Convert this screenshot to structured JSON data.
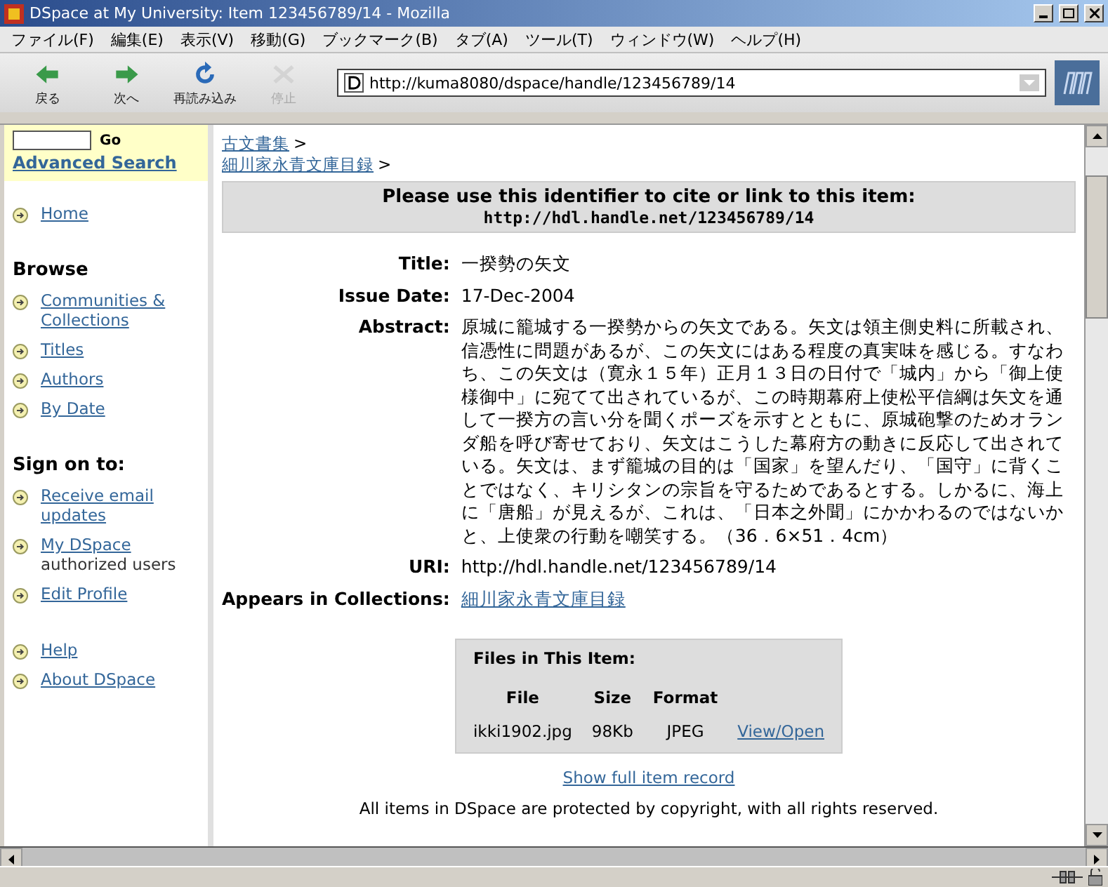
{
  "window": {
    "title": "DSpace at My University: Item 123456789/14 - Mozilla"
  },
  "menu": [
    "ファイル(F)",
    "編集(E)",
    "表示(V)",
    "移動(G)",
    "ブックマーク(B)",
    "タブ(A)",
    "ツール(T)",
    "ウィンドウ(W)",
    "ヘルプ(H)"
  ],
  "toolbar": [
    {
      "label": "戻る",
      "kind": "back",
      "disabled": false
    },
    {
      "label": "次へ",
      "kind": "forward",
      "disabled": false
    },
    {
      "label": "再読み込み",
      "kind": "reload",
      "disabled": false
    },
    {
      "label": "停止",
      "kind": "stop",
      "disabled": true
    }
  ],
  "address": {
    "url": "http://kuma8080/dspace/handle/123456789/14"
  },
  "sidebar": {
    "search": {
      "go": "Go",
      "advanced": "Advanced Search"
    },
    "groups": [
      {
        "items": [
          {
            "label": "Home"
          }
        ]
      },
      {
        "heading": "Browse",
        "items": [
          {
            "label": "Communities & Collections"
          },
          {
            "label": "Titles"
          },
          {
            "label": "Authors"
          },
          {
            "label": "By Date"
          }
        ]
      },
      {
        "heading": "Sign on to:",
        "items": [
          {
            "label": "Receive email updates"
          },
          {
            "label": "My DSpace",
            "note": "authorized users"
          },
          {
            "label": "Edit Profile"
          }
        ]
      },
      {
        "items": [
          {
            "label": "Help"
          },
          {
            "label": "About DSpace"
          }
        ]
      }
    ]
  },
  "breadcrumbs": [
    {
      "label": "古文書集",
      "separator": ">"
    },
    {
      "label": "細川家永青文庫目録",
      "separator": ">"
    }
  ],
  "identifier": {
    "message": "Please use this identifier to cite or link to this item:",
    "handle": "http://hdl.handle.net/123456789/14"
  },
  "fields": [
    {
      "label": "Title:",
      "value": "一揆勢の矢文",
      "kind": "text"
    },
    {
      "label": "Issue Date:",
      "value": "17-Dec-2004",
      "kind": "text"
    },
    {
      "label": "Abstract:",
      "value": "原城に籠城する一揆勢からの矢文である。矢文は領主側史料に所載され、信憑性に問題があるが、この矢文にはある程度の真実味を感じる。すなわち、この矢文は（寛永１５年）正月１３日の日付で「城内」から「御上使様御中」に宛てて出されているが、この時期幕府上使松平信綱は矢文を通して一揆方の言い分を聞くポーズを示すとともに、原城砲撃のためオランダ船を呼び寄せており、矢文はこうした幕府方の動きに反応して出されている。矢文は、まず籠城の目的は「国家」を望んだり、「国守」に背くことではなく、キリシタンの宗旨を守るためであるとする。しかるに、海上に「唐船」が見えるが、これは、「日本之外聞」にかかわるのではないかと、上使衆の行動を嘲笑する。（36．6×51．4cm）",
      "kind": "text"
    },
    {
      "label": "URI:",
      "value": "http://hdl.handle.net/123456789/14",
      "kind": "text"
    },
    {
      "label": "Appears in Collections:",
      "value": "細川家永青文庫目録",
      "kind": "link"
    }
  ],
  "files": {
    "title": "Files in This Item:",
    "columns": [
      "File",
      "Size",
      "Format"
    ],
    "rows": [
      {
        "file": "ikki1902.jpg",
        "size": "98Kb",
        "format": "JPEG",
        "link": "View/Open"
      }
    ]
  },
  "full_record": "Show full item record",
  "footer": "All items in DSpace are protected by copyright, with all rights reserved."
}
